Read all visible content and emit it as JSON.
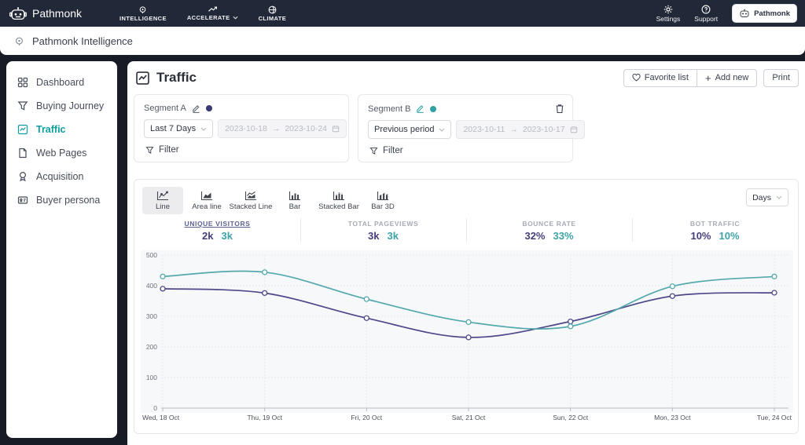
{
  "navbar": {
    "brand": "Pathmonk",
    "menu": [
      {
        "label": "INTELLIGENCE"
      },
      {
        "label": "ACCELERATE",
        "has_dropdown": true
      },
      {
        "label": "CLIMATE"
      }
    ],
    "settings_label": "Settings",
    "support_label": "Support",
    "account_button": "Pathmonk"
  },
  "subheader": {
    "title": "Pathmonk Intelligence"
  },
  "sidebar": {
    "items": [
      {
        "label": "Dashboard",
        "active": false
      },
      {
        "label": "Buying Journey",
        "active": false
      },
      {
        "label": "Traffic",
        "active": true
      },
      {
        "label": "Web Pages",
        "active": false
      },
      {
        "label": "Acquisition",
        "active": false
      },
      {
        "label": "Buyer persona",
        "active": false
      }
    ]
  },
  "main": {
    "title": "Traffic",
    "actions": {
      "favorite": "Favorite list",
      "add_new": "Add new",
      "add_new_plus": "+",
      "print": "Print"
    },
    "segments": [
      {
        "name": "Segment A",
        "color": "#3b3a72",
        "range_label": "Last 7 Days",
        "date_start": "2023-10-18",
        "date_arrow": "→",
        "date_end": "2023-10-24",
        "filter_label": "Filter"
      },
      {
        "name": "Segment B",
        "color": "#2fa3a3",
        "range_label": "Previous period",
        "date_start": "2023-10-11",
        "date_arrow": "→",
        "date_end": "2023-10-17",
        "filter_label": "Filter"
      }
    ],
    "chart_tabs": [
      {
        "label": "Line",
        "active": true
      },
      {
        "label": "Area line",
        "active": false
      },
      {
        "label": "Stacked Line",
        "active": false
      },
      {
        "label": "Bar",
        "active": false
      },
      {
        "label": "Stacked Bar",
        "active": false
      },
      {
        "label": "Bar 3D",
        "active": false
      }
    ],
    "interval_select": "Days",
    "metrics": [
      {
        "label": "UNIQUE VISITORS",
        "a": "2k",
        "b": "3k",
        "active": true
      },
      {
        "label": "TOTAL PAGEVIEWS",
        "a": "3k",
        "b": "3k",
        "active": false
      },
      {
        "label": "BOUNCE RATE",
        "a": "32%",
        "b": "33%",
        "active": false
      },
      {
        "label": "BOT TRAFFIC",
        "a": "10%",
        "b": "10%",
        "active": false
      }
    ]
  },
  "chart_data": {
    "type": "line",
    "title": "Unique visitors by day, Segment A vs Segment B",
    "x": [
      "Wed, 18 Oct",
      "Thu, 19 Oct",
      "Fri, 20 Oct",
      "Sat, 21 Oct",
      "Sun, 22 Oct",
      "Mon, 23 Oct",
      "Tue, 24 Oct"
    ],
    "series": [
      {
        "name": "Segment A",
        "color": "#4c4889",
        "values": [
          390,
          376,
          294,
          231,
          283,
          366,
          377
        ]
      },
      {
        "name": "Segment B",
        "color": "#54a8ac",
        "values": [
          430,
          444,
          356,
          281,
          267,
          398,
          430
        ]
      }
    ],
    "ylim": [
      0,
      500
    ],
    "yticks": [
      0,
      100,
      200,
      300,
      400,
      500
    ],
    "grid": true,
    "legend": "none",
    "plot_bg": "#f7f8fa"
  },
  "colors": {
    "navbar_bg": "#212837",
    "page_bg": "#161b25",
    "accent_teal": "#0d9f9f",
    "segment_a_value": "#443e7c",
    "segment_b_value": "#3da3a6"
  }
}
